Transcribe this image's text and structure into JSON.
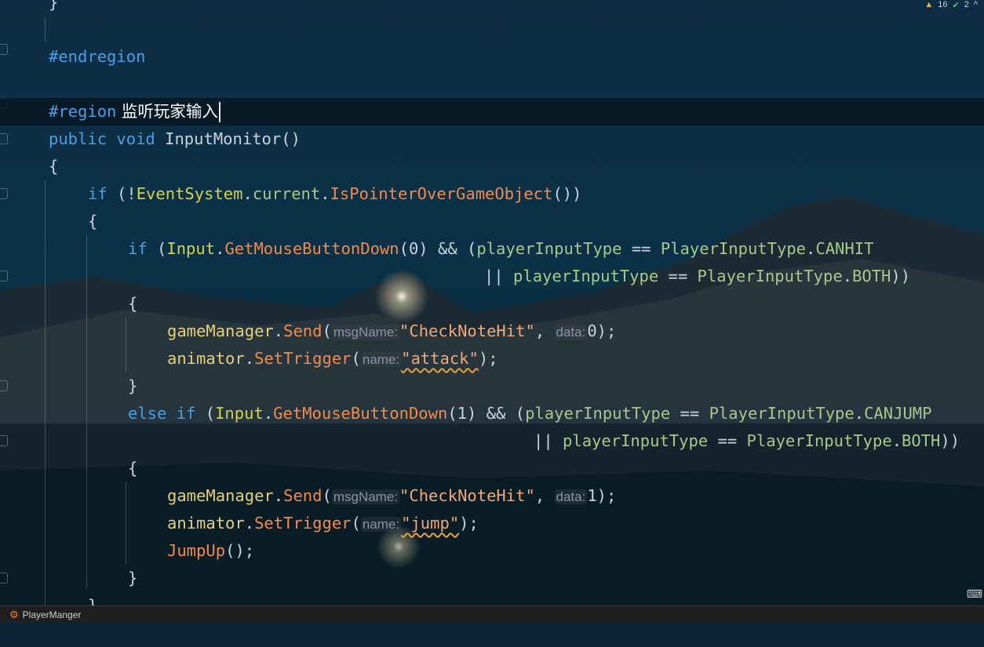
{
  "inspections": {
    "warnings": "16",
    "ok": "2",
    "collapse": "^"
  },
  "status": {
    "file_label": "PlayerManger"
  },
  "editor": {
    "l0": {
      "brace": "}"
    },
    "l2": {
      "directive": "#endregion"
    },
    "l4": {
      "directive": "#region",
      "comment": " 监听玩家输入"
    },
    "l5": {
      "kw1": "public",
      "kw2": "void",
      "name": "InputMonitor",
      "paren": "()"
    },
    "l6": {
      "brace": "{"
    },
    "l7": {
      "kw": "if",
      "p1": " (!",
      "type": "EventSystem",
      "dot1": ".",
      "field": "current",
      "dot2": ".",
      "method": "IsPointerOverGameObject",
      "p2": "())"
    },
    "l8": {
      "brace": "{"
    },
    "l9": {
      "kw": "if",
      "p1": " (",
      "type": "Input",
      "dot": ".",
      "method": "GetMouseButtonDown",
      "p2": "(",
      "num": "0",
      "p3": ") && (",
      "var": "playerInputType",
      "op": " == ",
      "enum": "PlayerInputType",
      "dot2": ".",
      "member": "CANHIT"
    },
    "l10": {
      "op1": "|| ",
      "var": "playerInputType",
      "op": " == ",
      "enum": "PlayerInputType",
      "dot": ".",
      "member": "BOTH",
      "p": "))"
    },
    "l11": {
      "brace": "{"
    },
    "l12": {
      "obj": "gameManager",
      "dot": ".",
      "method": "Send",
      "p1": "(",
      "hint1": "msgName:",
      "str": "\"CheckNoteHit\"",
      "comma": ", ",
      "hint2": "data:",
      "num": "0",
      "p2": ");"
    },
    "l13": {
      "obj": "animator",
      "dot": ".",
      "method": "SetTrigger",
      "p1": "(",
      "hint": "name:",
      "str": "\"attack\"",
      "p2": ");"
    },
    "l14": {
      "brace": "}"
    },
    "l15": {
      "kw1": "else",
      "kw2": "if",
      "p1": " (",
      "type": "Input",
      "dot": ".",
      "method": "GetMouseButtonDown",
      "p2": "(",
      "num": "1",
      "p3": ") && (",
      "var": "playerInputType",
      "op": " == ",
      "enum": "PlayerInputType",
      "dot2": ".",
      "member": "CANJUMP"
    },
    "l16": {
      "op1": "|| ",
      "var": "playerInputType",
      "op": " == ",
      "enum": "PlayerInputType",
      "dot": ".",
      "member": "BOTH",
      "p": "))"
    },
    "l17": {
      "brace": "{"
    },
    "l18": {
      "obj": "gameManager",
      "dot": ".",
      "method": "Send",
      "p1": "(",
      "hint1": "msgName:",
      "str": "\"CheckNoteHit\"",
      "comma": ", ",
      "hint2": "data:",
      "num": "1",
      "p2": ");"
    },
    "l19": {
      "obj": "animator",
      "dot": ".",
      "method": "SetTrigger",
      "p1": "(",
      "hint": "name:",
      "str": "\"jump\"",
      "p2": ");"
    },
    "l20": {
      "method": "JumpUp",
      "p": "();"
    },
    "l21": {
      "brace": "}"
    },
    "l22": {
      "brace": "}"
    }
  },
  "colors": {
    "keyword": "#4a9fe6",
    "type": "#d4d24a",
    "method": "#f28b4c",
    "string": "#f2a876",
    "field": "#a7c98a"
  },
  "icons": {
    "status_file": "unity-component-icon",
    "warning": "warning-icon",
    "ok": "check-icon",
    "ime": "input-method-icon"
  }
}
